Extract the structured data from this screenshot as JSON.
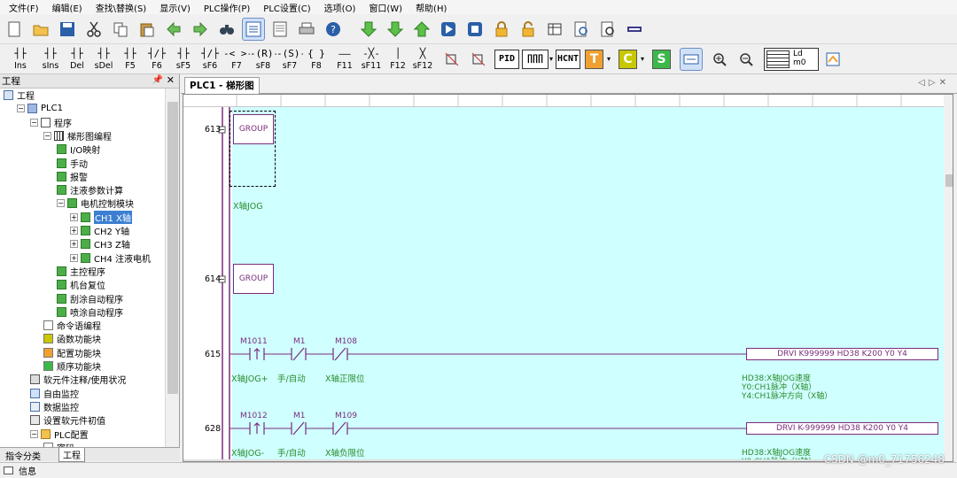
{
  "menu": [
    "文件(F)",
    "编辑(E)",
    "查找\\替换(S)",
    "显示(V)",
    "PLC操作(P)",
    "PLC设置(C)",
    "选项(O)",
    "窗口(W)",
    "帮助(H)"
  ],
  "toolbar1": {
    "icons": [
      "new-file-icon",
      "open-folder-icon",
      "save-icon",
      "cut-icon",
      "copy-icon",
      "paste-icon",
      "back-icon",
      "forward-icon",
      "find-icon",
      "ladder-view-icon",
      "list-view-icon",
      "print-icon",
      "help-icon",
      "download-icon",
      "upload-icon",
      "upload-green-icon",
      "run-icon",
      "stop-icon",
      "lock-icon",
      "unlock-icon",
      "monitor-icon",
      "zoom-page-icon",
      "find-page-icon",
      "module-icon"
    ]
  },
  "toolbar2": {
    "ladder_keys": [
      {
        "sym": "┤├",
        "key": "Ins"
      },
      {
        "sym": "┤├",
        "key": "sIns"
      },
      {
        "sym": "┤├",
        "key": "Del"
      },
      {
        "sym": "┤├",
        "key": "sDel"
      },
      {
        "sym": "┤├",
        "key": "F5"
      },
      {
        "sym": "┤/├",
        "key": "F6"
      },
      {
        "sym": "┤├",
        "key": "sF5"
      },
      {
        "sym": "┤/├",
        "key": "sF6"
      },
      {
        "sym": "-< >-",
        "key": "F7"
      },
      {
        "sym": "-(R)-",
        "key": "sF8"
      },
      {
        "sym": "-(S)-",
        "key": "sF7"
      },
      {
        "sym": "{  }",
        "key": "F8"
      },
      {
        "sym": "——",
        "key": "F11"
      },
      {
        "sym": "-╳-",
        "key": "sF11"
      },
      {
        "sym": "│",
        "key": "F12"
      },
      {
        "sym": "╳",
        "key": "sF12"
      }
    ],
    "buttons": [
      "PID",
      "∏∏∏",
      "HCNT"
    ],
    "color_buttons": [
      {
        "label": "T",
        "color": "#f0a030"
      },
      {
        "label": "C",
        "color": "#c8c800"
      },
      {
        "label": "S",
        "color": "#3cb84a"
      }
    ],
    "ldm_label": "Ld m0"
  },
  "left_panel": {
    "title": "工程",
    "tree": [
      {
        "label": "工程",
        "depth": 0,
        "expand": "",
        "icon": "project-icon"
      },
      {
        "label": "PLC1",
        "depth": 1,
        "expand": "−",
        "icon": "plc-icon"
      },
      {
        "label": "程序",
        "depth": 2,
        "expand": "−",
        "icon": "program-icon"
      },
      {
        "label": "梯形图编程",
        "depth": 3,
        "expand": "−",
        "icon": "ladder-icon"
      },
      {
        "label": "I/O映射",
        "depth": 4,
        "expand": "",
        "icon": "module-green-icon"
      },
      {
        "label": "手动",
        "depth": 4,
        "expand": "",
        "icon": "module-green-icon"
      },
      {
        "label": "报警",
        "depth": 4,
        "expand": "",
        "icon": "module-green-icon"
      },
      {
        "label": "注液参数计算",
        "depth": 4,
        "expand": "",
        "icon": "module-green-icon"
      },
      {
        "label": "电机控制模块",
        "depth": 4,
        "expand": "−",
        "icon": "module-green-icon"
      },
      {
        "label": "CH1 X轴",
        "depth": 5,
        "expand": "+",
        "icon": "module-green-icon",
        "selected": true
      },
      {
        "label": "CH2 Y轴",
        "depth": 5,
        "expand": "+",
        "icon": "module-green-icon"
      },
      {
        "label": "CH3 Z轴",
        "depth": 5,
        "expand": "+",
        "icon": "module-green-icon"
      },
      {
        "label": "CH4 注液电机",
        "depth": 5,
        "expand": "+",
        "icon": "module-green-icon"
      },
      {
        "label": "主控程序",
        "depth": 4,
        "expand": "",
        "icon": "module-green-icon"
      },
      {
        "label": "机台复位",
        "depth": 4,
        "expand": "",
        "icon": "module-green-icon"
      },
      {
        "label": "刮涂自动程序",
        "depth": 4,
        "expand": "",
        "icon": "module-green-icon"
      },
      {
        "label": "喷涂自动程序",
        "depth": 4,
        "expand": "",
        "icon": "module-green-icon"
      },
      {
        "label": "命令语编程",
        "depth": 3,
        "expand": "",
        "icon": "command-icon"
      },
      {
        "label": "函数功能块",
        "depth": 3,
        "expand": "",
        "icon": "function-block-icon"
      },
      {
        "label": "配置功能块",
        "depth": 3,
        "expand": "",
        "icon": "config-block-icon"
      },
      {
        "label": "顺序功能块",
        "depth": 3,
        "expand": "",
        "icon": "sequence-block-icon"
      },
      {
        "label": "软元件注释/使用状况",
        "depth": 2,
        "expand": "",
        "icon": "comment-icon"
      },
      {
        "label": "自由监控",
        "depth": 2,
        "expand": "",
        "icon": "monitor-doc-icon"
      },
      {
        "label": "数据监控",
        "depth": 2,
        "expand": "",
        "icon": "data-monitor-icon"
      },
      {
        "label": "设置软元件初值",
        "depth": 2,
        "expand": "",
        "icon": "init-value-icon"
      },
      {
        "label": "PLC配置",
        "depth": 2,
        "expand": "−",
        "icon": "folder-icon"
      },
      {
        "label": "密码",
        "depth": 3,
        "expand": "",
        "icon": "password-icon"
      }
    ],
    "tabs": [
      "指令分类",
      "工程"
    ]
  },
  "status_bar": {
    "label": "信息"
  },
  "editor": {
    "tab_label": "PLC1 - 梯形图",
    "rungs": [
      {
        "no": "613",
        "group": "GROUP",
        "comment": "X轴JOG"
      },
      {
        "no": "614",
        "group": "GROUP"
      },
      {
        "no": "615",
        "contacts": [
          {
            "device": "M1011",
            "comment": "X轴JOG+",
            "type": "rising"
          },
          {
            "device": "M1",
            "comment": "手/自动",
            "type": "nc"
          },
          {
            "device": "M108",
            "comment": "X轴正限位",
            "type": "nc"
          }
        ],
        "instruction": "DRVI K999999 HD38 K200 Y0 Y4",
        "notes": [
          "HD38:X轴JOG速度",
          "Y0:CH1脉冲（X轴）",
          "Y4:CH1脉冲方向（X轴）"
        ]
      },
      {
        "no": "628",
        "contacts": [
          {
            "device": "M1012",
            "comment": "X轴JOG-",
            "type": "rising"
          },
          {
            "device": "M1",
            "comment": "手/自动",
            "type": "nc"
          },
          {
            "device": "M109",
            "comment": "X轴负限位",
            "type": "nc"
          }
        ],
        "instruction": "DRVI K-999999 HD38 K200 Y0 Y4",
        "notes": [
          "HD38:X轴JOG速度",
          "Y0:CH1脉冲（X轴）"
        ]
      }
    ]
  },
  "watermark": "CSDN @m0_71756248",
  "colors": {
    "canvas": "#cfffff",
    "instruction": "#7b2c7b",
    "comment": "#2b8b2b",
    "selection": "#3c7fd1"
  }
}
